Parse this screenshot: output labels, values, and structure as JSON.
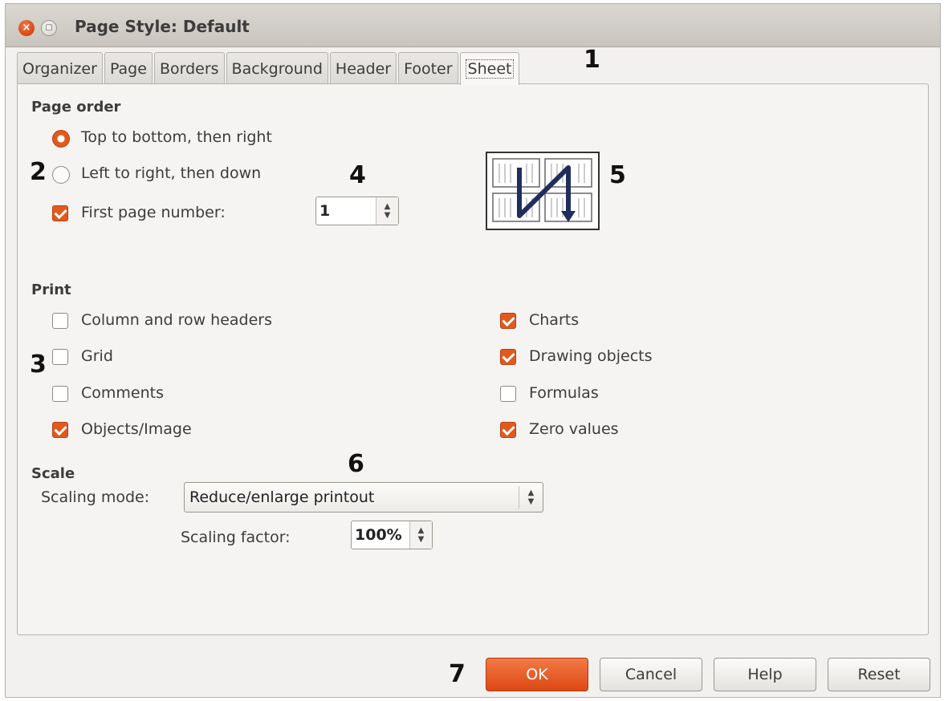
{
  "window": {
    "title": "Page Style: Default",
    "close_glyph": "×",
    "max_glyph": "▢"
  },
  "tabs": [
    "Organizer",
    "Page",
    "Borders",
    "Background",
    "Header",
    "Footer",
    "Sheet"
  ],
  "active_tab": "Sheet",
  "page_order": {
    "heading": "Page order",
    "radio_top_to_bottom": {
      "label": "Top to bottom, then right",
      "checked": true
    },
    "radio_left_to_right": {
      "label": "Left to right, then down",
      "checked": false
    },
    "first_page_number": {
      "label": "First page number:",
      "checked": true,
      "value": "1"
    }
  },
  "print": {
    "heading": "Print",
    "column_row_headers": {
      "label": "Column and row headers",
      "checked": false
    },
    "grid": {
      "label": "Grid",
      "checked": false
    },
    "comments": {
      "label": "Comments",
      "checked": false
    },
    "objects_image": {
      "label": "Objects/Image",
      "checked": true
    },
    "charts": {
      "label": "Charts",
      "checked": true
    },
    "drawing_objects": {
      "label": "Drawing objects",
      "checked": true
    },
    "formulas": {
      "label": "Formulas",
      "checked": false
    },
    "zero_values": {
      "label": "Zero values",
      "checked": true
    }
  },
  "scale": {
    "heading": "Scale",
    "scaling_mode_label": "Scaling mode:",
    "scaling_mode_value": "Reduce/enlarge printout",
    "scaling_factor_label": "Scaling factor:",
    "scaling_factor_value": "100%"
  },
  "buttons": {
    "ok": "OK",
    "cancel": "Cancel",
    "help": "Help",
    "reset": "Reset"
  },
  "callouts": [
    "1",
    "2",
    "3",
    "4",
    "5",
    "6",
    "7"
  ],
  "colors": {
    "accent": "#dd4814",
    "dialog_bg": "#f2f1f0"
  },
  "icons": {
    "spin_up": "▲",
    "spin_down": "▼"
  }
}
